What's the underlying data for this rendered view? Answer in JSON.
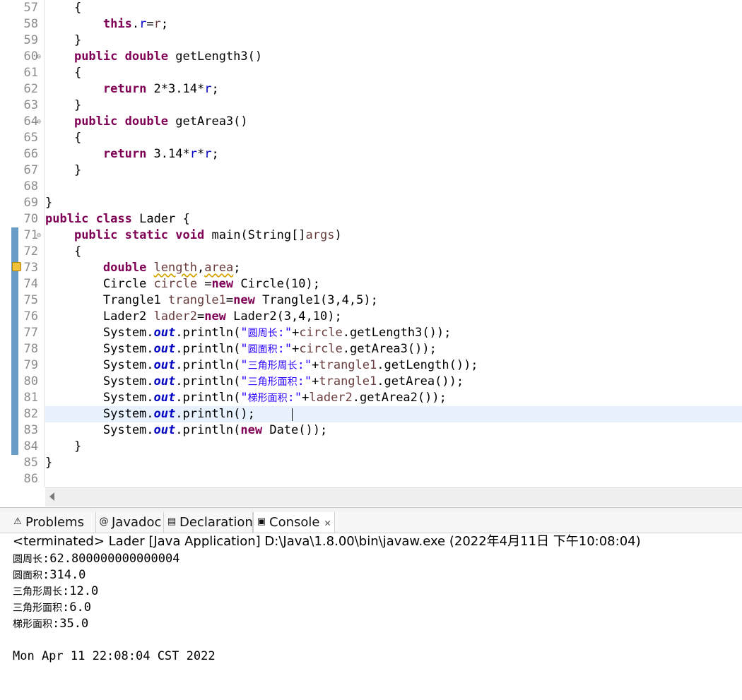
{
  "editor": {
    "lines": [
      {
        "n": "57",
        "fold": "",
        "html": "    {"
      },
      {
        "n": "58",
        "fold": "",
        "html": "        <span class=\"k\">this</span>.<span class=\"f\">r</span>=<span class=\"v\">r</span>;"
      },
      {
        "n": "59",
        "fold": "",
        "html": "    }"
      },
      {
        "n": "60",
        "fold": "⊖",
        "html": "    <span class=\"k\">public</span> <span class=\"k\">double</span> getLength3()"
      },
      {
        "n": "61",
        "fold": "",
        "html": "    {"
      },
      {
        "n": "62",
        "fold": "",
        "html": "        <span class=\"k\">return</span> 2*3.14*<span class=\"f\">r</span>;"
      },
      {
        "n": "63",
        "fold": "",
        "html": "    }"
      },
      {
        "n": "64",
        "fold": "⊖",
        "html": "    <span class=\"k\">public</span> <span class=\"k\">double</span> getArea3()"
      },
      {
        "n": "65",
        "fold": "",
        "html": "    {"
      },
      {
        "n": "66",
        "fold": "",
        "html": "        <span class=\"k\">return</span> 3.14*<span class=\"f\">r</span>*<span class=\"f\">r</span>;"
      },
      {
        "n": "67",
        "fold": "",
        "html": "    }"
      },
      {
        "n": "68",
        "fold": "",
        "html": ""
      },
      {
        "n": "69",
        "fold": "",
        "html": "}"
      },
      {
        "n": "70",
        "fold": "",
        "html": "<span class=\"k\">public</span> <span class=\"k\">class</span> Lader {"
      },
      {
        "n": "71",
        "fold": "⊖",
        "html": "    <span class=\"k\">public</span> <span class=\"k\">static</span> <span class=\"k\">void</span> main(String[]<span class=\"v\">args</span>)"
      },
      {
        "n": "72",
        "fold": "",
        "html": "    {"
      },
      {
        "n": "73",
        "fold": "",
        "html": "        <span class=\"k\">double</span> <span class=\"v sq\">length</span>,<span class=\"v sq\">area</span>;"
      },
      {
        "n": "74",
        "fold": "",
        "html": "        Circle <span class=\"v\">circle</span> =<span class=\"k\">new</span> Circle(10);"
      },
      {
        "n": "75",
        "fold": "",
        "html": "        Trangle1 <span class=\"v\">trangle1</span>=<span class=\"k\">new</span> Trangle1(3,4,5);"
      },
      {
        "n": "76",
        "fold": "",
        "html": "        Lader2 <span class=\"v\">lader2</span>=<span class=\"k\">new</span> Lader2(3,4,10);"
      },
      {
        "n": "77",
        "fold": "",
        "html": "        System.<span class=\"fi\">out</span>.println(<span class=\"s\">\"<span class=\"cjk\">圆周长</span>:\"</span>+<span class=\"v\">circle</span>.getLength3());"
      },
      {
        "n": "78",
        "fold": "",
        "html": "        System.<span class=\"fi\">out</span>.println(<span class=\"s\">\"<span class=\"cjk\">圆面积</span>:\"</span>+<span class=\"v\">circle</span>.getArea3());"
      },
      {
        "n": "79",
        "fold": "",
        "html": "        System.<span class=\"fi\">out</span>.println(<span class=\"s\">\"<span class=\"cjk\">三角形周长</span>:\"</span>+<span class=\"v\">trangle1</span>.getLength());"
      },
      {
        "n": "80",
        "fold": "",
        "html": "        System.<span class=\"fi\">out</span>.println(<span class=\"s\">\"<span class=\"cjk\">三角形面积</span>:\"</span>+<span class=\"v\">trangle1</span>.getArea());"
      },
      {
        "n": "81",
        "fold": "",
        "html": "        System.<span class=\"fi\">out</span>.println(<span class=\"s\">\"<span class=\"cjk\">梯形面积</span>:\"</span>+<span class=\"v\">lader2</span>.getArea2());"
      },
      {
        "n": "82",
        "fold": "",
        "html": "        System.<span class=\"fi\">out</span>.println();"
      },
      {
        "n": "83",
        "fold": "",
        "html": "        System.<span class=\"fi\">out</span>.println(<span class=\"k\">new</span> Date());"
      },
      {
        "n": "84",
        "fold": "",
        "html": "    }"
      },
      {
        "n": "85",
        "fold": "",
        "html": "}"
      },
      {
        "n": "86",
        "fold": "",
        "html": ""
      }
    ]
  },
  "tabs": [
    {
      "id": "problems",
      "label": "Problems",
      "icon": "⚠",
      "close": ""
    },
    {
      "id": "javadoc",
      "label": "Javadoc",
      "icon": "@",
      "close": ""
    },
    {
      "id": "declaration",
      "label": "Declaration",
      "icon": "▤",
      "close": ""
    },
    {
      "id": "console",
      "label": "Console",
      "icon": "▣",
      "close": "✕"
    }
  ],
  "console": {
    "status": "<terminated> Lader [Java Application] D:\\Java\\1.8.00\\bin\\javaw.exe (2022年4月11日 下午10:08:04)",
    "output": [
      {
        "label": "圆周长",
        "value": ":62.800000000000004"
      },
      {
        "label": "圆面积",
        "value": ":314.0"
      },
      {
        "label": "三角形周长",
        "value": ":12.0"
      },
      {
        "label": "三角形面积",
        "value": ":6.0"
      },
      {
        "label": "梯形面积",
        "value": ":35.0"
      },
      {
        "label": "",
        "value": ""
      },
      {
        "label": "",
        "value": "Mon Apr 11 22:08:04 CST 2022"
      }
    ]
  },
  "colors": {
    "keyword": "#7f0055",
    "field": "#0000c0",
    "string": "#2a00ff",
    "local": "#6a3e3e",
    "marker": "#6a9cc8"
  }
}
